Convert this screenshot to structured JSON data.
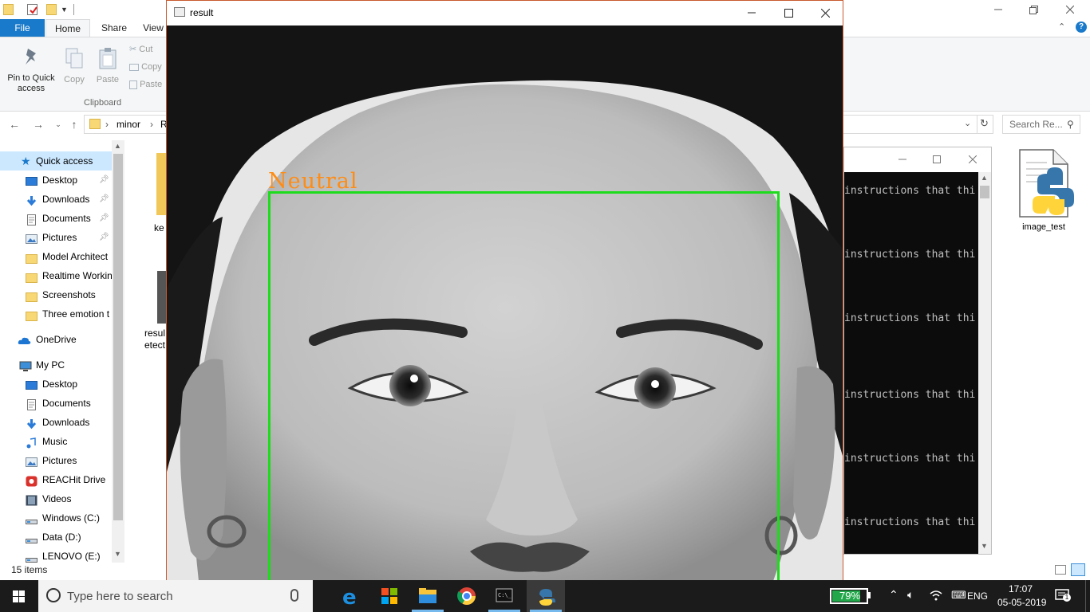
{
  "explorer": {
    "ribbon_tabs": [
      "File",
      "Home",
      "Share",
      "View"
    ],
    "clipboard": {
      "pin_label_1": "Pin to Quick",
      "pin_label_2": "access",
      "copy": "Copy",
      "paste": "Paste",
      "cut": "Cut",
      "copy_path": "Copy",
      "paste_shortcut": "Paste",
      "group": "Clipboard"
    },
    "address": {
      "segment1": "minor",
      "segment2": "R"
    },
    "search_placeholder": "Search Re...",
    "nav": {
      "quick_access": "Quick access",
      "quick_items": [
        {
          "label": "Desktop",
          "icon": "desktop-icon"
        },
        {
          "label": "Downloads",
          "icon": "downloads-icon"
        },
        {
          "label": "Documents",
          "icon": "documents-icon"
        },
        {
          "label": "Pictures",
          "icon": "pictures-icon"
        },
        {
          "label": "Model Architect",
          "icon": "folder-icon"
        },
        {
          "label": "Realtime Workin",
          "icon": "folder-icon"
        },
        {
          "label": "Screenshots",
          "icon": "folder-icon"
        },
        {
          "label": "Three emotion t",
          "icon": "folder-icon"
        }
      ],
      "onedrive": "OneDrive",
      "mypc": "My PC",
      "pc_items": [
        {
          "label": "Desktop",
          "icon": "desktop-icon"
        },
        {
          "label": "Documents",
          "icon": "documents-icon"
        },
        {
          "label": "Downloads",
          "icon": "downloads-icon"
        },
        {
          "label": "Music",
          "icon": "music-icon"
        },
        {
          "label": "Pictures",
          "icon": "pictures-icon"
        },
        {
          "label": "REACHit Drive",
          "icon": "reachit-icon"
        },
        {
          "label": "Videos",
          "icon": "videos-icon"
        },
        {
          "label": "Windows (C:)",
          "icon": "drive-icon"
        },
        {
          "label": "Data (D:)",
          "icon": "drive-icon"
        },
        {
          "label": "LENOVO (E:)",
          "icon": "drive-icon"
        }
      ]
    },
    "partial_files": [
      "ke",
      "resul",
      "etect"
    ],
    "status": "15 items"
  },
  "result_window": {
    "title": "result",
    "emotion_label": "Neutral",
    "box_color": "#1cdc1c",
    "label_color": "#ff8c14"
  },
  "console": {
    "lines": [
      "instructions that thi",
      "instructions that thi",
      "instructions that thi",
      "instructions that thi",
      "instructions that thi",
      "instructions that thi"
    ]
  },
  "desktop_icon": {
    "label": "image_test"
  },
  "taskbar": {
    "search_placeholder": "Type here to search",
    "battery": "79%",
    "language": "ENG",
    "time": "17:07",
    "date": "05-05-2019",
    "notifications": "1"
  }
}
